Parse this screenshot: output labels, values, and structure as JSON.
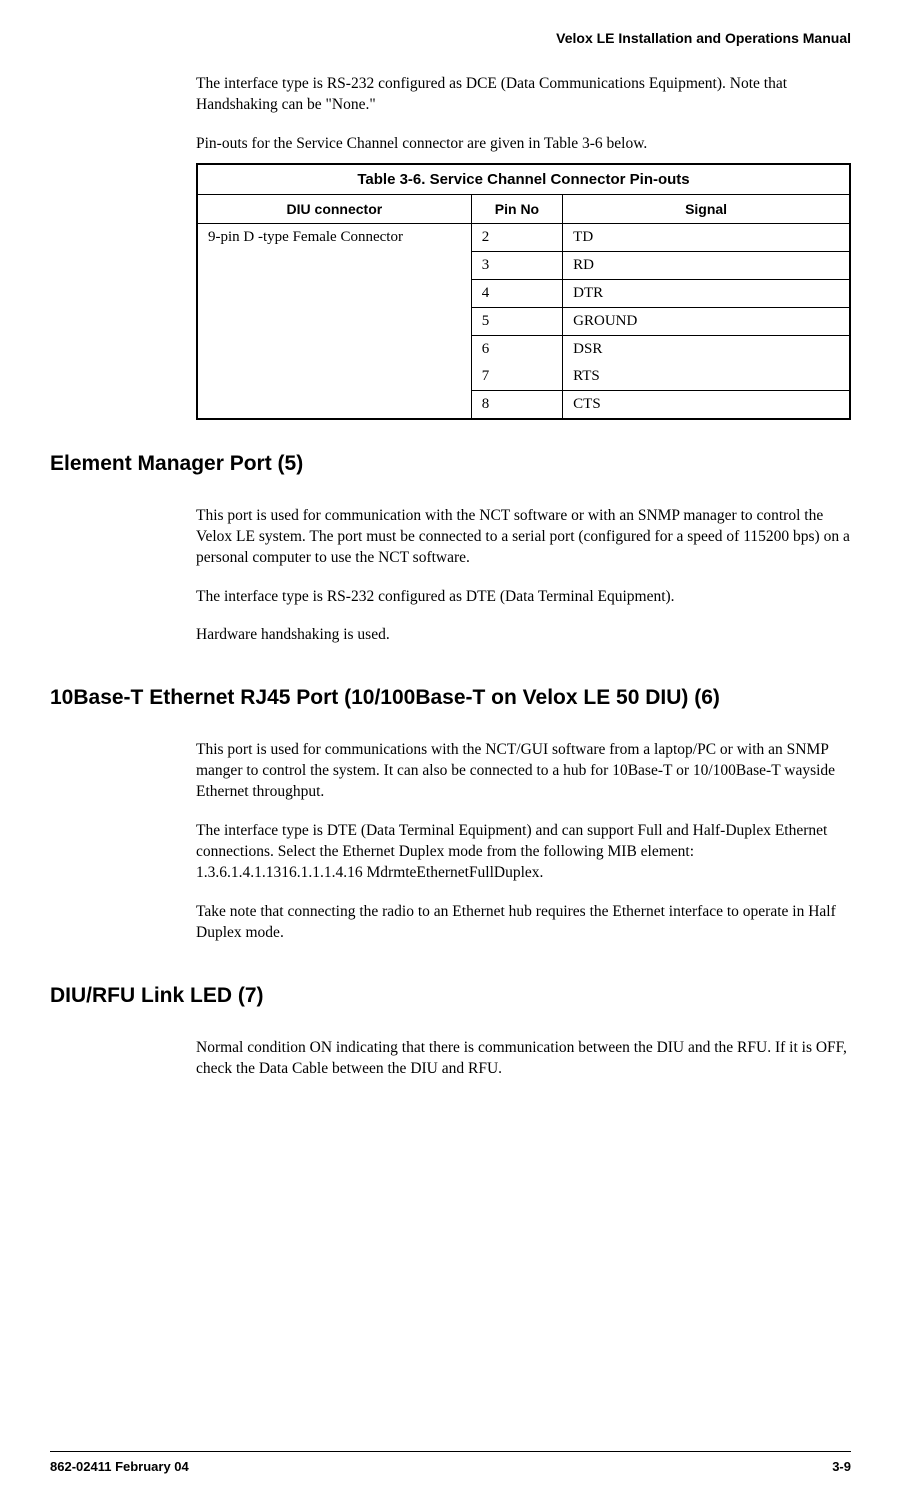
{
  "header": {
    "title": "Velox LE Installation and Operations Manual"
  },
  "intro": {
    "p1": "The interface type is RS-232 configured as DCE (Data Communications Equipment). Note that Handshaking can be \"None.\"",
    "p2": "Pin-outs for the Service Channel connector are given in Table 3-6 below."
  },
  "table": {
    "caption": "Table 3-6.  Service Channel Connector Pin-outs",
    "headers": {
      "c1": "DIU connector",
      "c2": "Pin No",
      "c3": "Signal"
    },
    "connector": "9-pin D -type Female Connector",
    "rows": [
      {
        "pin": "2",
        "signal": "TD"
      },
      {
        "pin": "3",
        "signal": "RD"
      },
      {
        "pin": "4",
        "signal": "DTR"
      },
      {
        "pin": "5",
        "signal": "GROUND"
      },
      {
        "pin": "6",
        "signal": "DSR"
      },
      {
        "pin": "7",
        "signal": "RTS"
      },
      {
        "pin": "8",
        "signal": "CTS"
      }
    ]
  },
  "section1": {
    "heading": "Element Manager Port (5)",
    "p1": "This port is used for communication with the NCT software or with an SNMP manager to control the Velox LE system.  The port must be connected to a serial port (configured for a speed of 115200 bps) on a personal computer to use the NCT software.",
    "p2": "The interface type is RS-232 configured as DTE (Data Terminal Equipment).",
    "p3": "Hardware handshaking is used."
  },
  "section2": {
    "heading": "10Base-T Ethernet RJ45 Port (10/100Base-T on Velox LE 50 DIU) (6)",
    "p1": "This port is used for communications with the NCT/GUI software from a laptop/PC or with an SNMP manger to control the system.  It can also be connected to a hub for 10Base-T or 10/100Base-T wayside Ethernet throughput.",
    "p2": "The interface type is DTE (Data Terminal Equipment) and can support Full and Half-Duplex Ethernet connections.  Select the Ethernet Duplex mode from the following MIB element: 1.3.6.1.4.1.1316.1.1.1.4.16 MdrmteEthernetFullDuplex.",
    "p3": "Take note that connecting the radio to an Ethernet hub requires the Ethernet interface to operate in Half Duplex mode."
  },
  "section3": {
    "heading": "DIU/RFU Link LED (7)",
    "p1": "Normal condition ON indicating that there is communication between the DIU and the RFU. If it is OFF, check the Data Cable between the DIU and RFU."
  },
  "footer": {
    "left": "862-02411 February 04",
    "right": "3-9"
  }
}
